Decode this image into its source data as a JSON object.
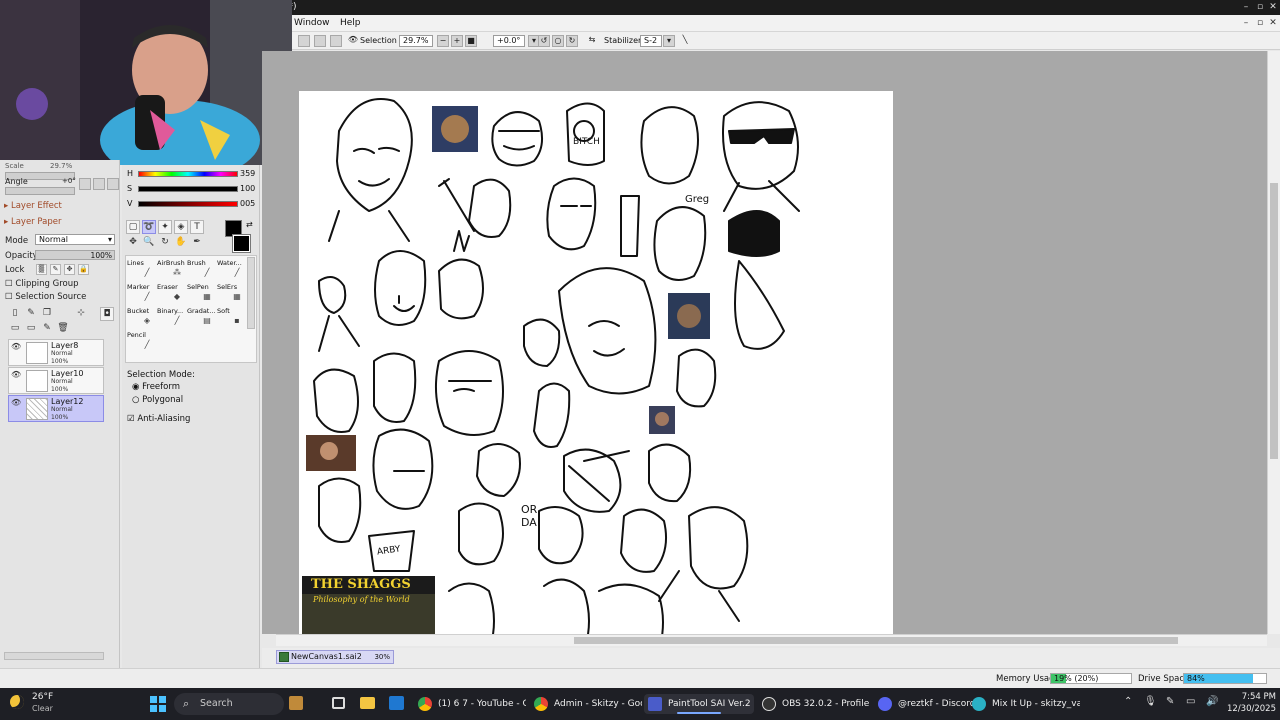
{
  "window": {
    "title_fragment": "(*)"
  },
  "menu": {
    "window": "Window",
    "help": "Help"
  },
  "toolbar": {
    "selection_label": "Selection",
    "zoom": "29.7%",
    "rotation": "+0.0°",
    "stabilizer_label": "Stabilizer",
    "stabilizer_value": "S-2"
  },
  "nav": {
    "scale_label": "Scale",
    "scale_value": "29.7%",
    "angle_label": "Angle",
    "angle_value": "+0°"
  },
  "layer_panel": {
    "layer_effect": "Layer Effect",
    "layer_paper": "Layer Paper",
    "mode_label": "Mode",
    "mode_value": "Normal",
    "opacity_label": "Opacity",
    "opacity_value": "100%",
    "lock_label": "Lock",
    "clipping_group": "Clipping Group",
    "selection_source": "Selection Source",
    "layers": [
      {
        "name": "Layer8",
        "mode": "Normal",
        "opacity": "100%",
        "selected": false
      },
      {
        "name": "Layer10",
        "mode": "Normal",
        "opacity": "100%",
        "selected": false
      },
      {
        "name": "Layer12",
        "mode": "Normal",
        "opacity": "100%",
        "selected": true
      }
    ]
  },
  "color": {
    "h_label": "H",
    "h_value": "359",
    "s_label": "S",
    "s_value": "100",
    "v_label": "V",
    "v_value": "005"
  },
  "brushes": [
    {
      "label": "Lines"
    },
    {
      "label": "AirBrush"
    },
    {
      "label": "Brush"
    },
    {
      "label": "Water..."
    },
    {
      "label": "Marker"
    },
    {
      "label": "Eraser"
    },
    {
      "label": "SelPen"
    },
    {
      "label": "SelErs"
    },
    {
      "label": "Bucket"
    },
    {
      "label": "Binary..."
    },
    {
      "label": "Gradat..."
    },
    {
      "label": "Soft"
    },
    {
      "label": "Pencil"
    }
  ],
  "selection_mode": {
    "title": "Selection Mode:",
    "options": [
      "Freeform",
      "Polygonal"
    ],
    "selected": "Freeform",
    "anti_aliasing": "Anti-Aliasing"
  },
  "canvas_labels": {
    "greg": "Greg",
    "bitch": "BITCH",
    "or_da": "OR DA",
    "arby": "ARBY",
    "shaggs_title": "THE SHAGGS",
    "shaggs_sub": "Philosophy of the World"
  },
  "document_tab": {
    "name": "NewCanvas1.sai2",
    "zoom": "30%"
  },
  "status": {
    "memory_label": "Memory Usage",
    "memory_value": "19% (20%)",
    "memory_fraction": 0.19,
    "drive_label": "Drive Space",
    "drive_value": "84%",
    "drive_fraction": 0.84
  },
  "taskbar": {
    "weather_temp": "26°F",
    "weather_desc": "Clear",
    "search": "Search",
    "items": [
      {
        "label": "(1) 6 7 - YouTube - Goo",
        "icon": "chrome-icon",
        "color": "#2a9d4b"
      },
      {
        "label": "Admin - Skitzy - Goog",
        "icon": "chrome-icon",
        "color": "#3b7be0"
      },
      {
        "label": "PaintTool SAI Ver.2 (64",
        "icon": "sai-icon",
        "color": "#4a5cc9"
      },
      {
        "label": "OBS 32.0.2 - Profile: St",
        "icon": "obs-icon",
        "color": "#333333"
      },
      {
        "label": "@reztkf - Discord",
        "icon": "discord-icon",
        "color": "#5865f2"
      },
      {
        "label": "Mix It Up - skitzy_va - ",
        "icon": "mixitup-icon",
        "color": "#2ab0c4"
      }
    ],
    "time": "7:54 PM",
    "date": "12/30/2025"
  }
}
